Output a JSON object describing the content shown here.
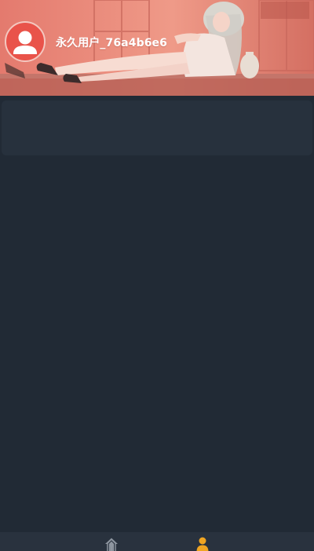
{
  "profile": {
    "username": "永久用户_76a4b6e6"
  },
  "tabbar": {
    "tabs": [
      {
        "id": "home",
        "icon": "home-icon",
        "active": false
      },
      {
        "id": "profile",
        "icon": "person-icon",
        "active": true
      }
    ]
  },
  "colors": {
    "banner_tint": "#e38a7d",
    "avatar_background": "#e9534a",
    "page_background": "#212a35",
    "card_background": "#27313d",
    "tabbar_background": "#29323e",
    "tab_inactive": "#8e96a0",
    "tab_active": "#f0a522"
  }
}
